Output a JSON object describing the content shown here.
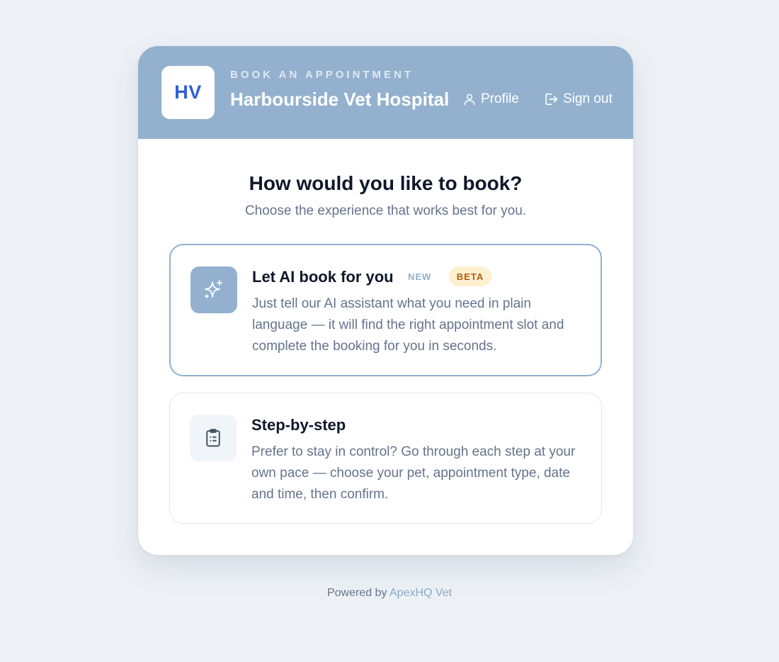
{
  "header": {
    "logo_initials": "HV",
    "eyebrow": "BOOK AN APPOINTMENT",
    "hospital_name": "Harbourside Vet Hospital",
    "profile_label": "Profile",
    "signout_label": "Sign out",
    "profile_icon": "user-icon",
    "signout_icon": "sign-out-icon"
  },
  "main": {
    "title": "How would you like to book?",
    "subtitle": "Choose the experience that works best for you.",
    "options": [
      {
        "icon": "sparkle-icon",
        "title": "Let AI book for you",
        "tag_new": "NEW",
        "tag_beta": "BETA",
        "description": "Just tell our AI assistant what you need in plain language — it will find the right appointment slot and complete the booking for you in seconds."
      },
      {
        "icon": "clipboard-list-icon",
        "title": "Step-by-step",
        "description": "Prefer to stay in control? Go through each step at your own pace — choose your pet, appointment type, date and time, then confirm."
      }
    ]
  },
  "footer": {
    "prefix": "Powered by",
    "brand": "ApexHQ Vet"
  },
  "colors": {
    "accent": "#93b1ce",
    "logo_text": "#2f5fd6",
    "beta_bg": "#fdf0cf",
    "beta_text": "#b45b12",
    "page_bg": "#edf1f6"
  }
}
